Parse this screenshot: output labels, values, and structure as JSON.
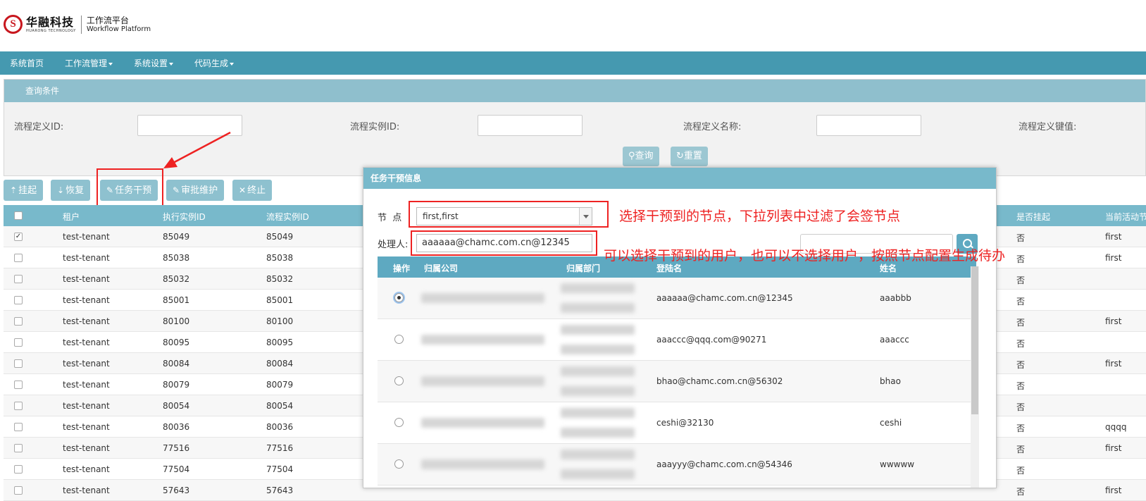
{
  "header": {
    "logo_mark": "S",
    "company_cn": "华融科技",
    "company_en": "HUARONG TECHNOLOGY",
    "platform_cn": "工作流平台",
    "platform_en": "Workflow Platform"
  },
  "nav": {
    "items": [
      {
        "label": "系统首页",
        "dropdown": false
      },
      {
        "label": "工作流管理",
        "dropdown": true
      },
      {
        "label": "系统设置",
        "dropdown": true
      },
      {
        "label": "代码生成",
        "dropdown": true
      }
    ]
  },
  "query": {
    "title": "查询条件",
    "fields": [
      {
        "label": "流程定义ID:",
        "value": ""
      },
      {
        "label": "流程实例ID:",
        "value": ""
      },
      {
        "label": "流程定义名称:",
        "value": ""
      },
      {
        "label": "流程定义键值:",
        "value": ""
      }
    ],
    "search_label": "查询",
    "reset_label": "重置"
  },
  "toolbar": {
    "suspend_label": "挂起",
    "restore_label": "恢复",
    "intervene_label": "任务干预",
    "approve_label": "审批维护",
    "terminate_label": "终止"
  },
  "grid": {
    "columns": [
      "租户",
      "执行实例ID",
      "流程实例ID",
      "是否挂起",
      "当前活动节"
    ],
    "rows": [
      {
        "checked": true,
        "tenant": "test-tenant",
        "exec_id": "85049",
        "proc_id": "85049",
        "suspended": "否",
        "activity": "first"
      },
      {
        "checked": false,
        "tenant": "test-tenant",
        "exec_id": "85038",
        "proc_id": "85038",
        "suspended": "否",
        "activity": "first"
      },
      {
        "checked": false,
        "tenant": "test-tenant",
        "exec_id": "85032",
        "proc_id": "85032",
        "suspended": "否",
        "activity": ""
      },
      {
        "checked": false,
        "tenant": "test-tenant",
        "exec_id": "85001",
        "proc_id": "85001",
        "suspended": "否",
        "activity": ""
      },
      {
        "checked": false,
        "tenant": "test-tenant",
        "exec_id": "80100",
        "proc_id": "80100",
        "suspended": "否",
        "activity": "first"
      },
      {
        "checked": false,
        "tenant": "test-tenant",
        "exec_id": "80095",
        "proc_id": "80095",
        "suspended": "否",
        "activity": ""
      },
      {
        "checked": false,
        "tenant": "test-tenant",
        "exec_id": "80084",
        "proc_id": "80084",
        "suspended": "否",
        "activity": "first"
      },
      {
        "checked": false,
        "tenant": "test-tenant",
        "exec_id": "80079",
        "proc_id": "80079",
        "suspended": "否",
        "activity": ""
      },
      {
        "checked": false,
        "tenant": "test-tenant",
        "exec_id": "80054",
        "proc_id": "80054",
        "suspended": "否",
        "activity": ""
      },
      {
        "checked": false,
        "tenant": "test-tenant",
        "exec_id": "80036",
        "proc_id": "80036",
        "suspended": "否",
        "activity": "qqqq"
      },
      {
        "checked": false,
        "tenant": "test-tenant",
        "exec_id": "77516",
        "proc_id": "77516",
        "suspended": "否",
        "activity": "first"
      },
      {
        "checked": false,
        "tenant": "test-tenant",
        "exec_id": "77504",
        "proc_id": "77504",
        "suspended": "否",
        "activity": ""
      },
      {
        "checked": false,
        "tenant": "test-tenant",
        "exec_id": "57643",
        "proc_id": "57643",
        "suspended": "否",
        "activity": "first"
      }
    ]
  },
  "dialog": {
    "title": "任务干预信息",
    "node_label": "节  点",
    "node_value": "first,first",
    "handler_label": "处理人:",
    "handler_value": "aaaaaa@chamc.com.cn@12345",
    "search_value": "",
    "user_columns": [
      "操作",
      "归属公司",
      "归属部门",
      "登陆名",
      "姓名"
    ],
    "users": [
      {
        "selected": true,
        "login": "aaaaaa@chamc.com.cn@12345",
        "name": "aaabbb"
      },
      {
        "selected": false,
        "login": "aaaccc@qqq.com@90271",
        "name": "aaaccc"
      },
      {
        "selected": false,
        "login": "bhao@chamc.com.cn@56302",
        "name": "bhao"
      },
      {
        "selected": false,
        "login": "ceshi@32130",
        "name": "ceshi"
      },
      {
        "selected": false,
        "login": "aaayyy@chamc.com.cn@54346",
        "name": "wwwww"
      }
    ]
  },
  "annotations": {
    "node_note": "选择干预到的节点，下拉列表中过滤了会签节点",
    "handler_note": "可以选择干预到的用户，也可以不选择用户，按照节点配置生成待办",
    "color": "#ee2222"
  }
}
